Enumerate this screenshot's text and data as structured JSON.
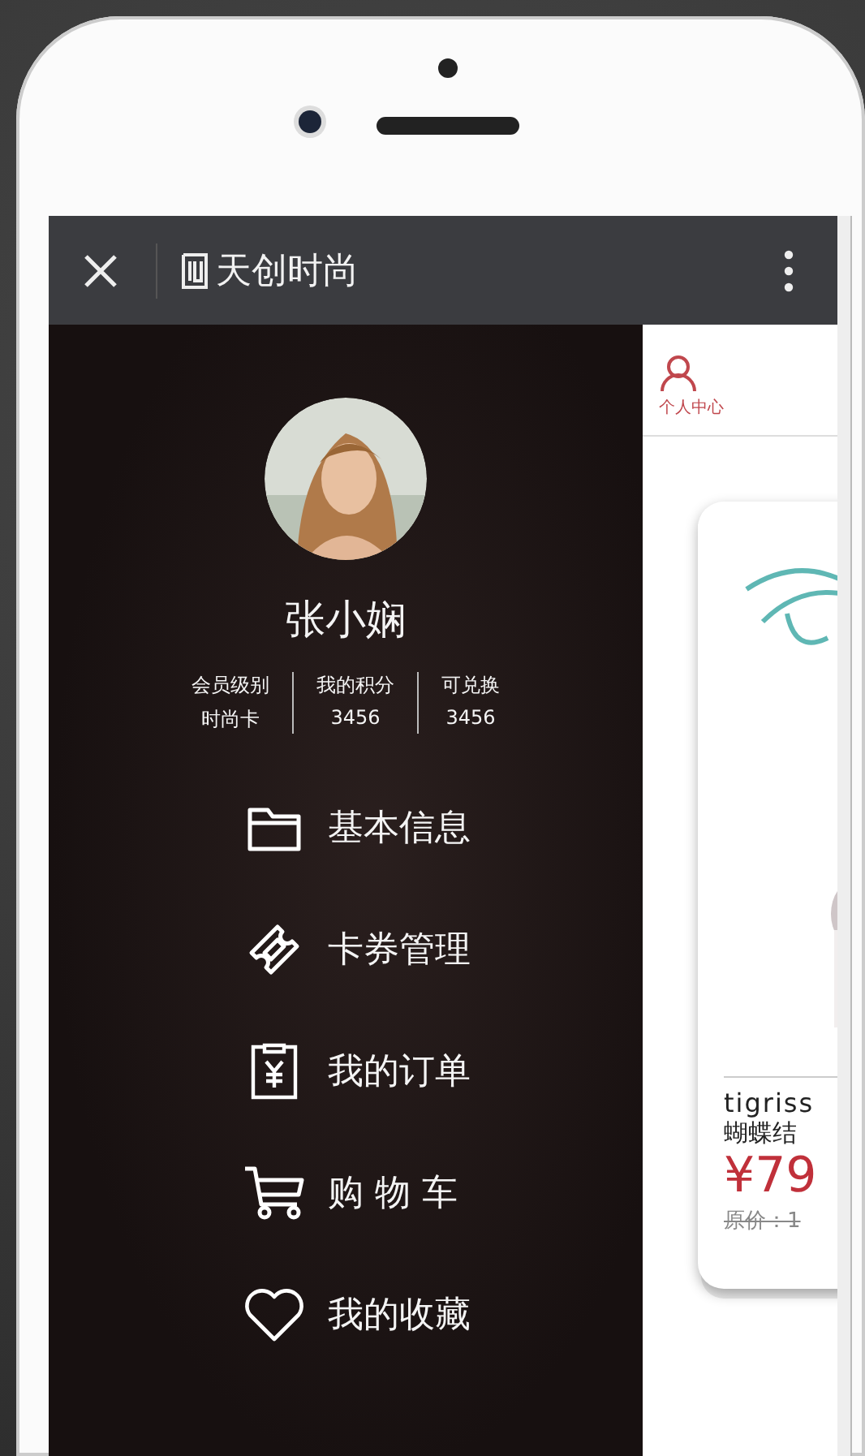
{
  "nav": {
    "title": "天创时尚"
  },
  "profile": {
    "name": "张小娴",
    "stats": [
      {
        "label": "会员级别",
        "value": "时尚卡"
      },
      {
        "label": "我的积分",
        "value": "3456"
      },
      {
        "label": "可兑换",
        "value": "3456"
      }
    ]
  },
  "menu": [
    {
      "label": "基本信息",
      "kind": "folder"
    },
    {
      "label": "卡券管理",
      "kind": "ticket"
    },
    {
      "label": "我的订单",
      "kind": "order"
    },
    {
      "label": "购 物 车",
      "kind": "cart"
    },
    {
      "label": "我的收藏",
      "kind": "heart"
    }
  ],
  "tab": {
    "label": "个人中心",
    "selected": true
  },
  "product": {
    "brand": "tigriss",
    "name": "蝴蝶结",
    "price": "¥79",
    "original_price": "原价：1"
  }
}
